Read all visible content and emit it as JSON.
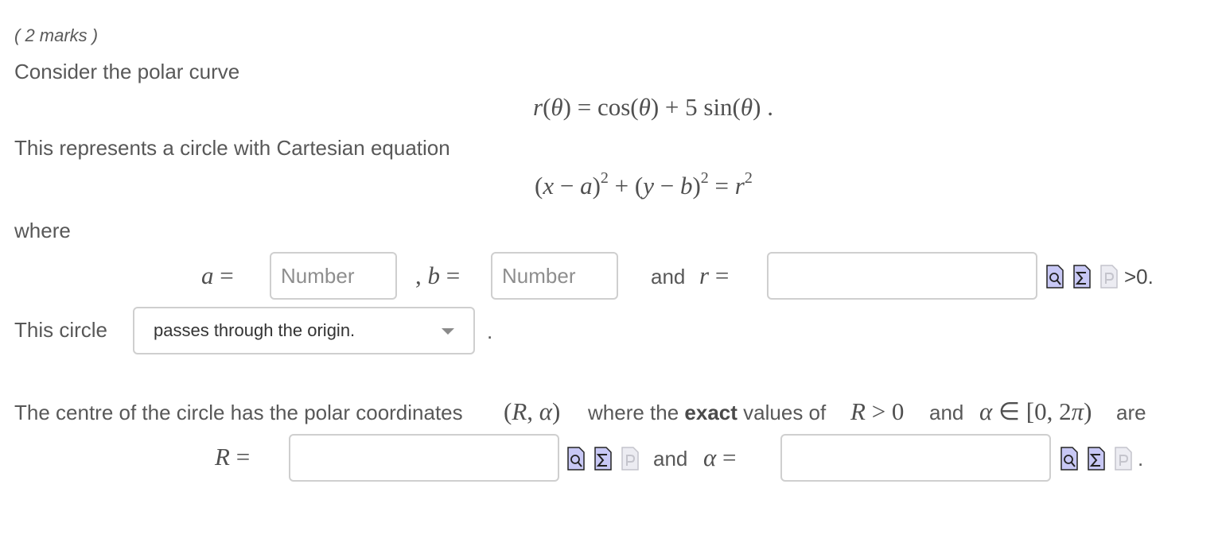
{
  "question": {
    "marks": "( 2 marks )",
    "intro": "Consider the polar curve",
    "polar_equation": "r(θ) = cos(θ) + 5 sin(θ) .",
    "cartesian_intro": "This represents a circle with Cartesian equation",
    "cartesian_equation": "(x − a)² + (y − b)² = r²",
    "where_label": "where"
  },
  "parameters": {
    "a_label": "a =",
    "a_placeholder": "Number",
    "a_value": "",
    "b_label": ", b =",
    "b_placeholder": "Number",
    "b_value": "",
    "and_label": "and",
    "r_label": "r =",
    "r_value": "",
    "r_suffix": ">0."
  },
  "circle_select": {
    "prefix": "This circle",
    "selected": "passes through the origin.",
    "suffix": "."
  },
  "centre": {
    "sentence_start": "The centre of the circle has the polar coordinates",
    "coords": "(R, α)",
    "where_the": "where the",
    "exact": "exact",
    "values_of": "values of",
    "R_cond": "R > 0",
    "and": "and",
    "alpha_cond": "α ∈ [0, 2π)",
    "are": "are",
    "R_label": "R =",
    "R_value": "",
    "and_label": "and",
    "alpha_label": "α =",
    "alpha_value": "",
    "end_period": "."
  },
  "icons": {
    "preview": "preview-icon",
    "equation_editor": "sigma-icon",
    "help": "help-icon"
  },
  "colors": {
    "text": "#585858",
    "border": "#cfcfcf",
    "icon_fill": "#c8c8f5",
    "icon_disabled": "#e8e8ee"
  }
}
